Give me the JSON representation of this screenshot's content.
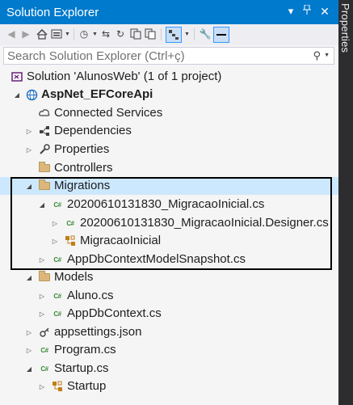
{
  "window": {
    "title": "Solution Explorer",
    "side_tab": "Properties"
  },
  "search": {
    "placeholder": "Search Solution Explorer (Ctrl+ç)"
  },
  "tree": [
    {
      "label": "Solution 'AlunosWeb' (1 of 1 project)",
      "icon": "solution-icon"
    },
    {
      "label": "AspNet_EFCoreApi",
      "icon": "web-project-icon"
    },
    {
      "label": "Connected Services",
      "icon": "connected-services-icon"
    },
    {
      "label": "Dependencies",
      "icon": "dependencies-icon"
    },
    {
      "label": "Properties",
      "icon": "wrench-icon"
    },
    {
      "label": "Controllers",
      "icon": "folder-icon"
    },
    {
      "label": "Migrations",
      "icon": "folder-open-icon"
    },
    {
      "label": "20200610131830_MigracaoInicial.cs",
      "icon": "csharp-file-icon"
    },
    {
      "label": "20200610131830_MigracaoInicial.Designer.cs",
      "icon": "csharp-file-icon"
    },
    {
      "label": "MigracaoInicial",
      "icon": "class-icon"
    },
    {
      "label": "AppDbContextModelSnapshot.cs",
      "icon": "csharp-file-icon"
    },
    {
      "label": "Models",
      "icon": "folder-open-icon"
    },
    {
      "label": "Aluno.cs",
      "icon": "csharp-file-icon"
    },
    {
      "label": "AppDbContext.cs",
      "icon": "csharp-file-icon"
    },
    {
      "label": "appsettings.json",
      "icon": "json-file-icon"
    },
    {
      "label": "Program.cs",
      "icon": "csharp-file-icon"
    },
    {
      "label": "Startup.cs",
      "icon": "csharp-file-icon"
    },
    {
      "label": "Startup",
      "icon": "class-icon"
    }
  ],
  "csharp_badge": "C#",
  "colors": {
    "title_bar": "#007acc",
    "selection": "#cce8ff",
    "csharp": "#388a34"
  }
}
